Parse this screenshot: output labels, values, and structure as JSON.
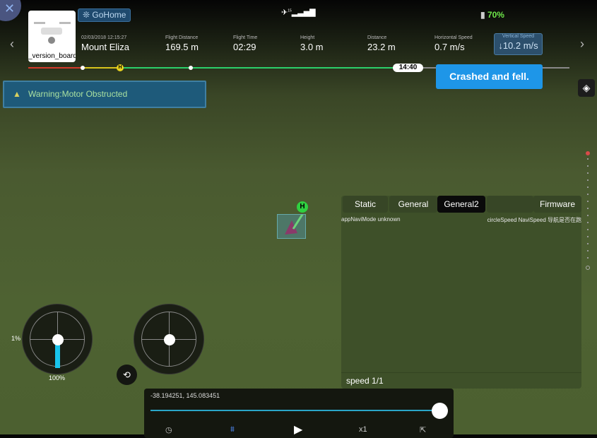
{
  "header": {
    "close_icon": "close-icon",
    "aircraft_label": "_version_board",
    "gohome_label": "GoHome",
    "satellite_count": "15",
    "battery": "70%",
    "date": "02/03/2018 12:15:27",
    "location": "Mount Eliza",
    "stats": [
      {
        "label": "Flight Distance",
        "value": "169.5 m"
      },
      {
        "label": "Flight Time",
        "value": "02:29"
      },
      {
        "label": "Height",
        "value": "3.0 m"
      },
      {
        "label": "Distance",
        "value": "23.2 m"
      },
      {
        "label": "Horizontal Speed",
        "value": "0.7 m/s"
      },
      {
        "label": "Vertical Speed",
        "value": "↓10.2 m/s"
      }
    ]
  },
  "timeline": {
    "time": "14:40",
    "tooltip": "Crashed and fell.",
    "progress_fraction": 0.74,
    "colors": {
      "red": "#d23a2a",
      "yellow": "#d8c41c",
      "green": "#2bd06a"
    }
  },
  "warning": {
    "text": "Warning:Motor Obstructed"
  },
  "panel": {
    "tabs": [
      "Static",
      "General",
      "General2",
      "",
      "Firmware"
    ],
    "active_tab": "General2",
    "left_text": "appNaviMode unknown",
    "right_text": "circleSpeed NaviSpeed 导航是否在跑",
    "speed": "speed 1/1"
  },
  "sticks": {
    "left_top_label": "1%",
    "left_bottom_label": "100%",
    "throttle_percent": 100
  },
  "player": {
    "coords": "-38.194251, 145.083451",
    "speed": "x1",
    "progress_fraction": 1.0
  }
}
